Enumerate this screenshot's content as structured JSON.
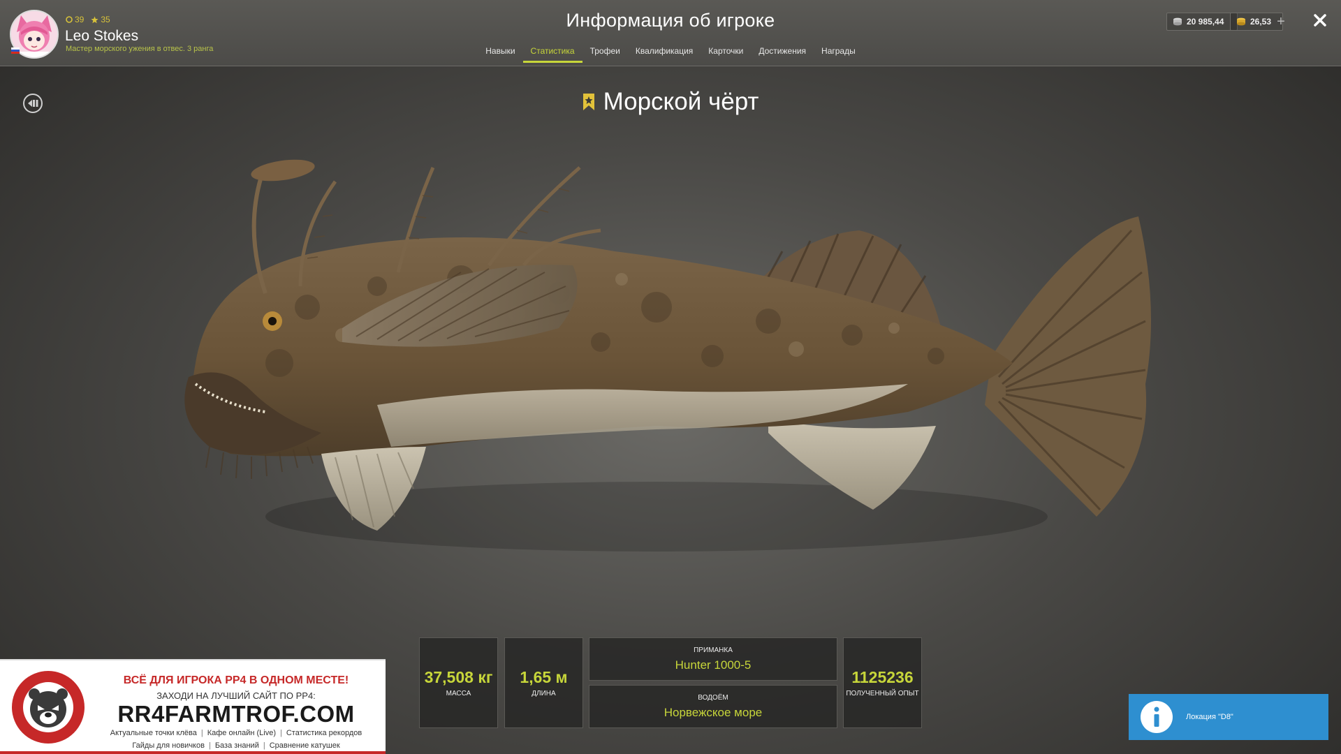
{
  "header": {
    "title": "Информация об игроке",
    "player": {
      "level": "39",
      "stars": "35",
      "name": "Leo Stokes",
      "title": "Мастер морского ужения в отвес. 3 ранга"
    },
    "currency": {
      "silver": "20 985,44",
      "gold": "26,53"
    },
    "tabs": [
      {
        "label": "Навыки"
      },
      {
        "label": "Статистика",
        "active": true
      },
      {
        "label": "Трофеи"
      },
      {
        "label": "Квалификация"
      },
      {
        "label": "Карточки"
      },
      {
        "label": "Достижения"
      },
      {
        "label": "Награды"
      }
    ]
  },
  "fish": {
    "name": "Морской чёрт"
  },
  "tiles": {
    "mass": {
      "value": "37,508 кг",
      "label": "МАССА"
    },
    "length": {
      "value": "1,65 м",
      "label": "ДЛИНА"
    },
    "bait": {
      "label": "ПРИМАНКА",
      "value": "Hunter 1000-5"
    },
    "water": {
      "label": "ВОДОЁМ",
      "value": "Норвежское море"
    },
    "exp": {
      "value": "1125236",
      "label": "ПОЛУЧЕННЫЙ ОПЫТ"
    }
  },
  "ad": {
    "headline": "ВСЁ ДЛЯ ИГРОКА РР4 В ОДНОМ МЕСТЕ!",
    "subline": "ЗАХОДИ НА ЛУЧШИЙ САЙТ ПО РР4:",
    "site": "RR4FARMTROF.COM",
    "links_row1": [
      "Актуальные точки клёва",
      "Кафе онлайн (Live)",
      "Статистика рекордов"
    ],
    "links_row2": [
      "Гайды для новичков",
      "База знаний",
      "Сравнение катушек"
    ]
  },
  "notification": {
    "text": "Локация \"D8\""
  },
  "colors": {
    "accent": "#c7d63a",
    "notification": "#2e8fd0",
    "ad_red": "#c62828"
  }
}
